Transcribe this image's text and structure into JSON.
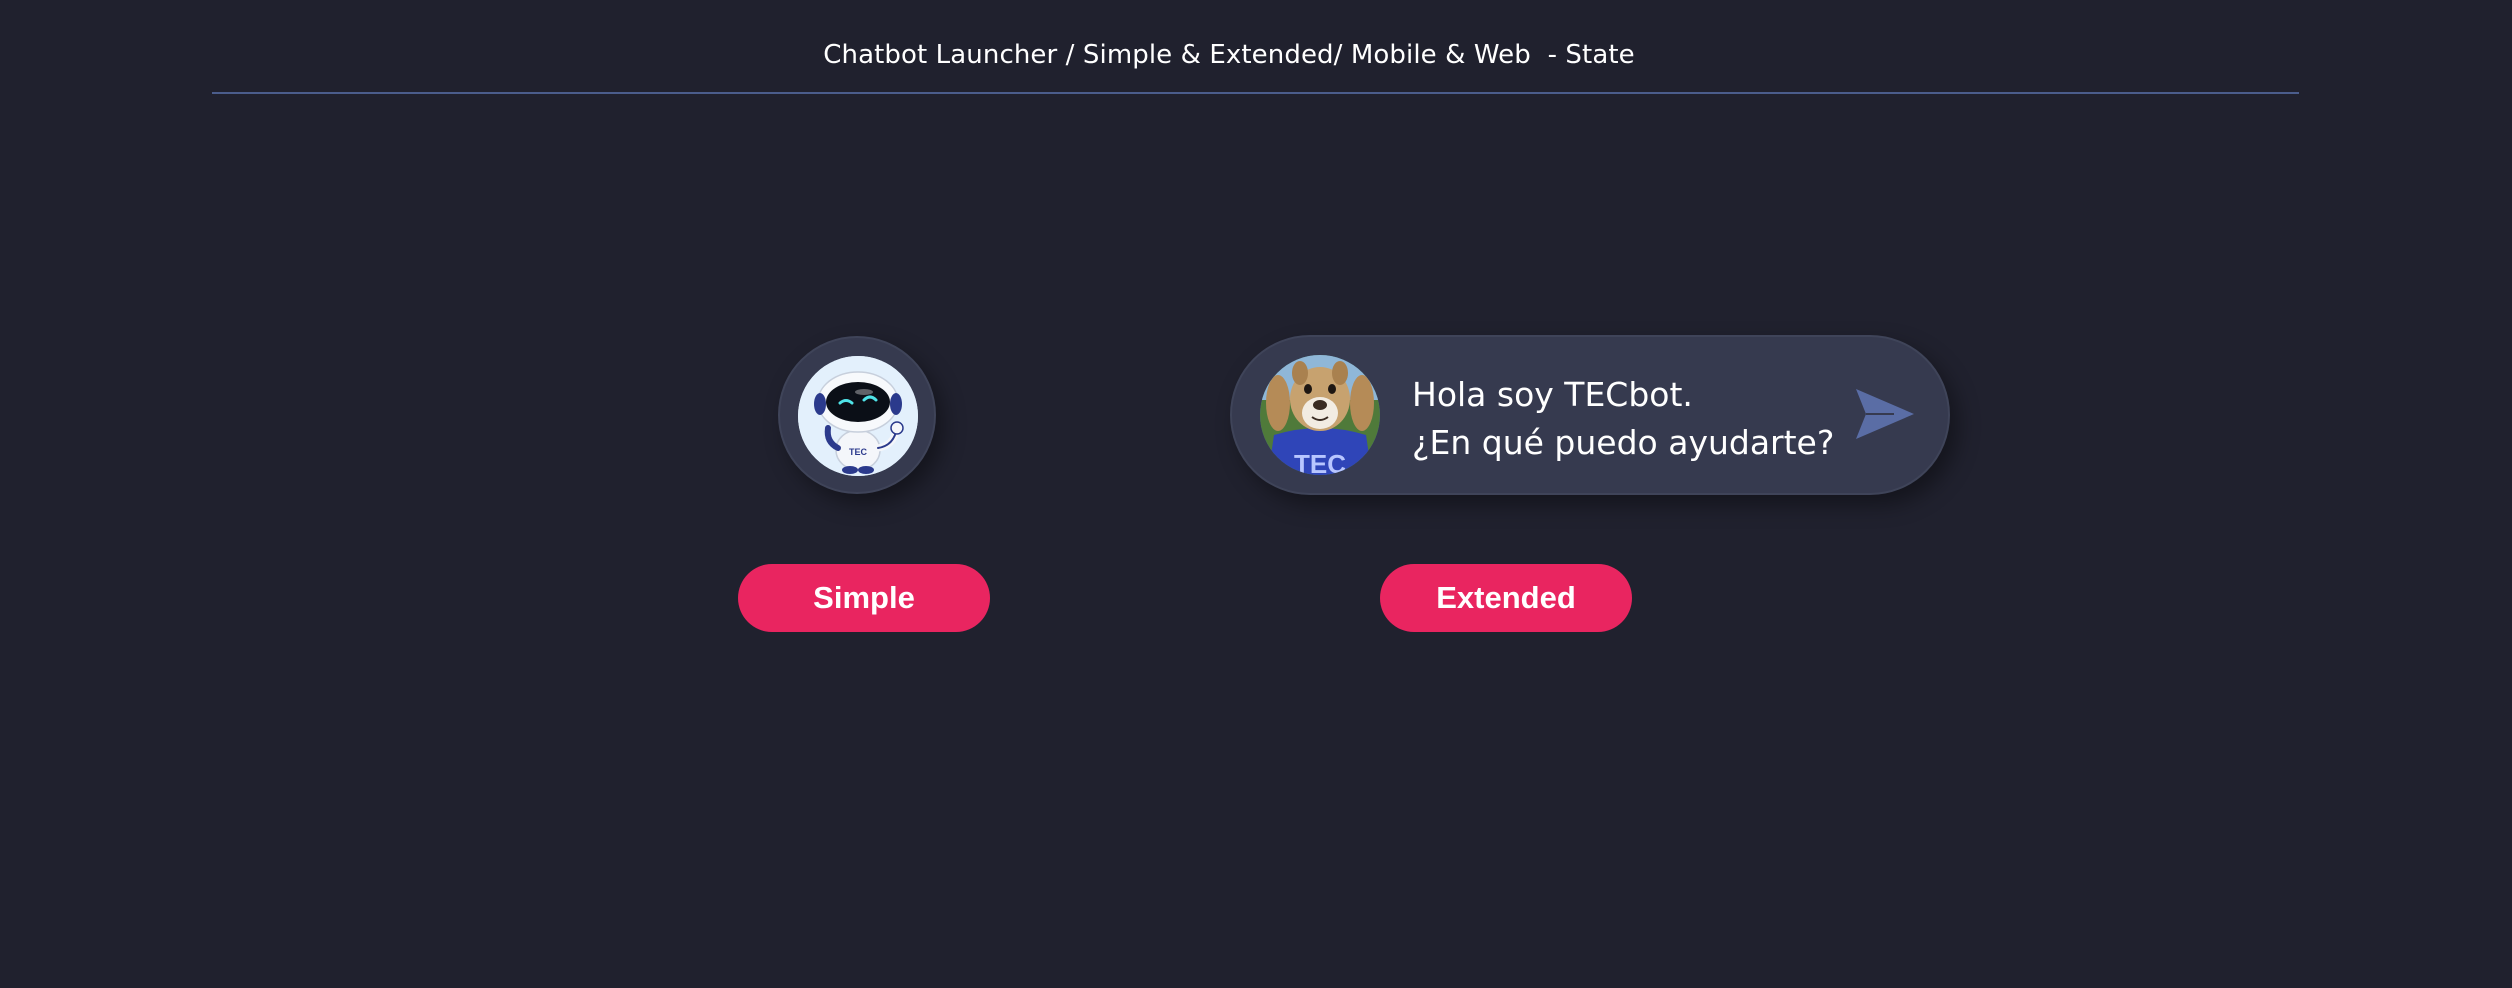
{
  "page": {
    "title": "Chatbot Launcher / Simple & Extended/ Mobile & Web  - State"
  },
  "simple_launcher": {
    "avatar_icon": "tecbot-robot-icon",
    "robot_badge": "TEC"
  },
  "extended_launcher": {
    "avatar_icon": "tec-mascot-icon",
    "mascot_shirt_text": "TEC",
    "greeting_line1": "Hola soy TECbot.",
    "greeting_line2": "¿En qué puedo ayudarte?",
    "send_icon": "send-arrow-icon"
  },
  "labels": {
    "simple": "Simple",
    "extended": "Extended"
  },
  "colors": {
    "background": "#20212e",
    "launcher_surface": "#363a4f",
    "accent_pink": "#e92560",
    "send_icon": "#5a6da5",
    "divider": "#4b5d8c"
  }
}
